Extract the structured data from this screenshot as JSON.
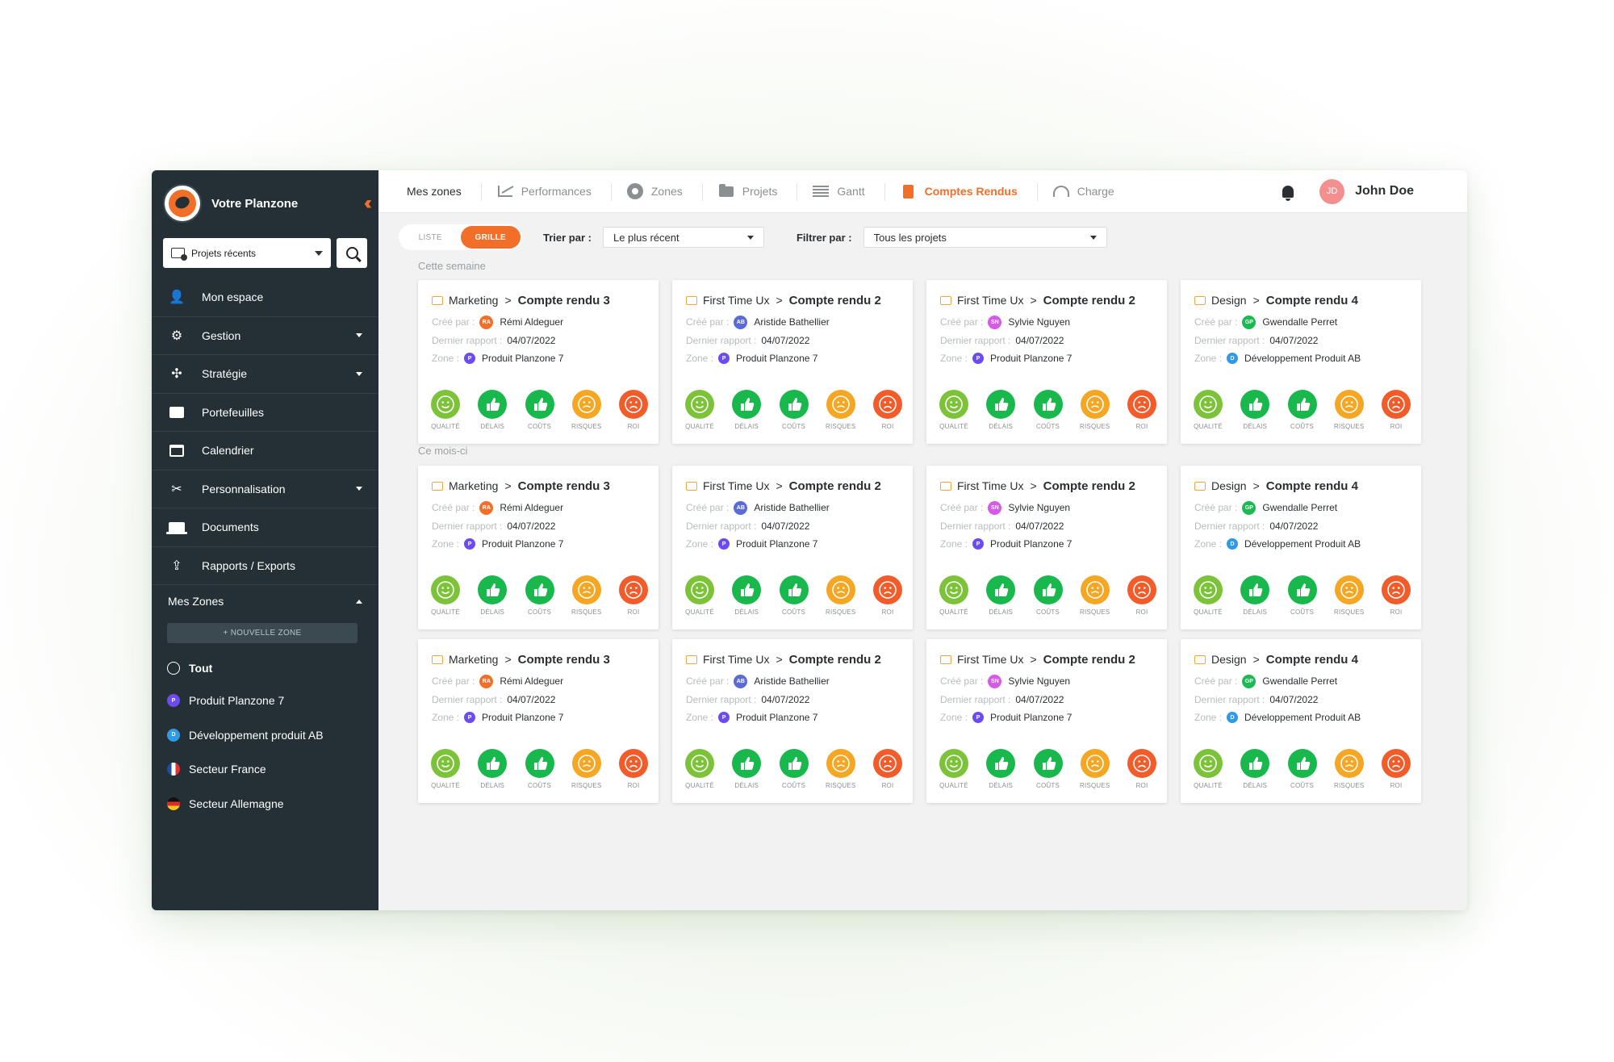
{
  "app": {
    "title": "Votre Planzone"
  },
  "colors": {
    "accent": "#f26f29",
    "sidebar": "#243036",
    "good": "#19b84d",
    "ok": "#7dc33a",
    "warn": "#f5a623",
    "bad": "#f25c2a"
  },
  "sidebar": {
    "recent_select": "Projets récents",
    "items": [
      {
        "label": "Mon espace",
        "icon": "user-lock-icon",
        "dropdown": false
      },
      {
        "label": "Gestion",
        "icon": "users-gear-icon",
        "dropdown": true
      },
      {
        "label": "Stratégie",
        "icon": "strategy-icon",
        "dropdown": true
      },
      {
        "label": "Portefeuilles",
        "icon": "wallet-icon",
        "dropdown": false
      },
      {
        "label": "Calendrier",
        "icon": "calendar-icon",
        "dropdown": false
      },
      {
        "label": "Personnalisation",
        "icon": "tools-icon",
        "dropdown": true
      },
      {
        "label": "Documents",
        "icon": "laptop-icon",
        "dropdown": false
      },
      {
        "label": "Rapports / Exports",
        "icon": "export-icon",
        "dropdown": false
      }
    ],
    "zones_title": "Mes Zones",
    "new_zone": "+ NOUVELLE ZONE",
    "zones": [
      {
        "label": "Tout",
        "badge": "",
        "color": "",
        "kind": "globe"
      },
      {
        "label": "Produit Planzone 7",
        "badge": "P",
        "color": "#6c4cf0",
        "kind": "badge"
      },
      {
        "label": "Développement produit AB",
        "badge": "D",
        "color": "#2f9be6",
        "kind": "badge"
      },
      {
        "label": "Secteur France",
        "badge": "",
        "color": "",
        "kind": "fr"
      },
      {
        "label": "Secteur Allemagne",
        "badge": "",
        "color": "",
        "kind": "de"
      }
    ]
  },
  "topbar": {
    "tabs": [
      {
        "label": "Mes zones",
        "icon": ""
      },
      {
        "label": "Performances",
        "icon": "performance-icon"
      },
      {
        "label": "Zones",
        "icon": "zones-icon"
      },
      {
        "label": "Projets",
        "icon": "folder-icon"
      },
      {
        "label": "Gantt",
        "icon": "gantt-icon"
      },
      {
        "label": "Comptes Rendus",
        "icon": "document-icon",
        "active": true
      },
      {
        "label": "Charge",
        "icon": "gauge-icon"
      }
    ],
    "user": {
      "initials": "JD",
      "name": "John Doe"
    }
  },
  "toolbar": {
    "view_list": "LISTE",
    "view_grid": "GRILLE",
    "sort_label": "Trier par :",
    "sort_value": "Le plus récent",
    "filter_label": "Filtrer par :",
    "filter_value": "Tous les projets"
  },
  "labels": {
    "created_by": "Créé par :",
    "last_report": "Dernier rapport :",
    "zone": "Zone :"
  },
  "kpi_labels": [
    "QUALITÉ",
    "DÉLAIS",
    "COÛTS",
    "RISQUES",
    "ROI"
  ],
  "kpi_states": [
    "ok",
    "good",
    "good",
    "warn",
    "bad"
  ],
  "cards_template": [
    {
      "project": "Marketing",
      "report": "Compte rendu 3",
      "author": "Rémi Aldeguer",
      "initials": "RA",
      "author_color": "#f26f29",
      "date": "04/07/2022",
      "zone": "Produit Planzone 7",
      "zone_badge": "P",
      "zone_color": "#6c4cf0"
    },
    {
      "project": "First Time Ux",
      "report": "Compte rendu 2",
      "author": "Aristide Bathellier",
      "initials": "AB",
      "author_color": "#5b6bd6",
      "date": "04/07/2022",
      "zone": "Produit Planzone 7",
      "zone_badge": "P",
      "zone_color": "#6c4cf0"
    },
    {
      "project": "First Time Ux",
      "report": "Compte rendu 2",
      "author": "Sylvie Nguyen",
      "initials": "SN",
      "author_color": "#d65ae8",
      "date": "04/07/2022",
      "zone": "Produit Planzone 7",
      "zone_badge": "P",
      "zone_color": "#6c4cf0"
    },
    {
      "project": "Design",
      "report": "Compte rendu 4",
      "author": "Gwendalle Perret",
      "initials": "GP",
      "author_color": "#1db954",
      "date": "04/07/2022",
      "zone": "Développement Produit AB",
      "zone_badge": "D",
      "zone_color": "#2f9be6"
    }
  ],
  "sections": [
    {
      "title": "Cette semaine",
      "rows": 1
    },
    {
      "title": "Ce mois-ci",
      "rows": 2
    }
  ]
}
